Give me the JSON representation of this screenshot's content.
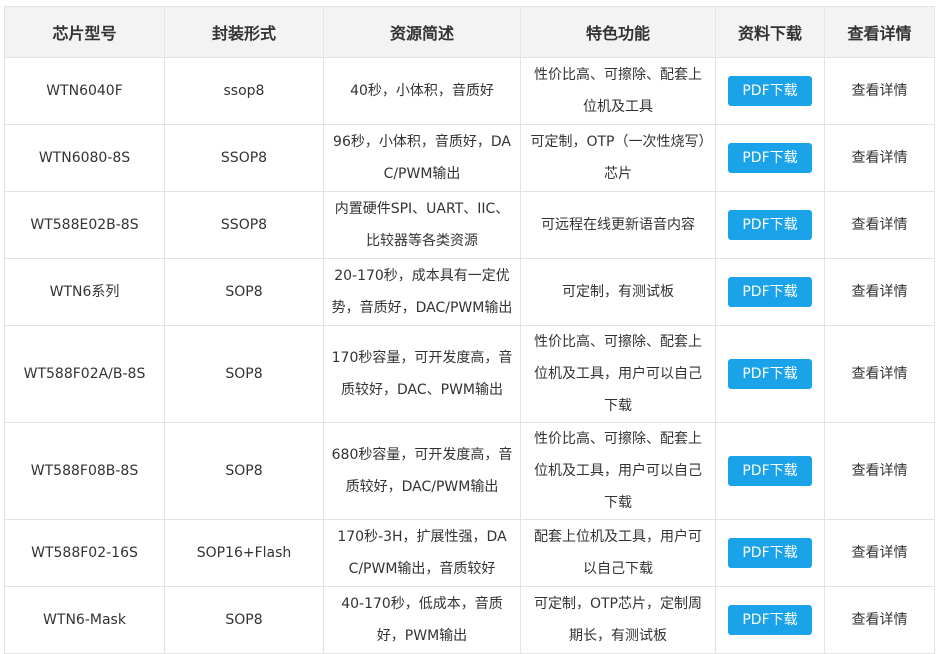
{
  "table": {
    "headers": [
      "芯片型号",
      "封装形式",
      "资源简述",
      "特色功能",
      "资料下载",
      "查看详情"
    ],
    "rows": [
      {
        "model": "WTN6040F",
        "package": "ssop8",
        "resources": "40秒，小体积，音质好",
        "features": "性价比高、可擦除、配套上位机及工具",
        "download": "PDF下载",
        "detail": "查看详情"
      },
      {
        "model": "WTN6080-8S",
        "package": "SSOP8",
        "resources": "96秒，小体积，音质好，DAC/PWM输出",
        "features": "可定制，OTP（一次性烧写）芯片",
        "download": "PDF下载",
        "detail": "查看详情"
      },
      {
        "model": "WT588E02B-8S",
        "package": "SSOP8",
        "resources": "内置硬件SPI、UART、IIC、比较器等各类资源",
        "features": "可远程在线更新语音内容",
        "download": "PDF下载",
        "detail": "查看详情"
      },
      {
        "model": "WTN6系列",
        "package": "SOP8",
        "resources": "20-170秒，成本具有一定优势，音质好，DAC/PWM输出",
        "features": "可定制，有测试板",
        "download": "PDF下载",
        "detail": "查看详情"
      },
      {
        "model": "WT588F02A/B-8S",
        "package": "SOP8",
        "resources": "170秒容量，可开发度高，音质较好，DAC、PWM输出",
        "features": "性价比高、可擦除、配套上位机及工具，用户可以自己下载",
        "download": "PDF下载",
        "detail": "查看详情"
      },
      {
        "model": "WT588F08B-8S",
        "package": "SOP8",
        "resources": "680秒容量，可开发度高，音质较好，DAC/PWM输出",
        "features": "性价比高、可擦除、配套上位机及工具，用户可以自己下载",
        "download": "PDF下载",
        "detail": "查看详情"
      },
      {
        "model": "WT588F02-16S",
        "package": "SOP16+Flash",
        "resources": "170秒-3H，扩展性强，DAC/PWM输出，音质较好",
        "features": "配套上位机及工具，用户可以自己下载",
        "download": "PDF下载",
        "detail": "查看详情"
      },
      {
        "model": "WTN6-Mask",
        "package": "SOP8",
        "resources": "40-170秒，低成本，音质好，PWM输出",
        "features": "可定制，OTP芯片，定制周期长，有测试板",
        "download": "PDF下载",
        "detail": "查看详情"
      }
    ]
  },
  "colors": {
    "header_bg": "#f3f3f3",
    "border": "#e3e3e3",
    "button_bg": "#1aa3e8",
    "text": "#333333"
  }
}
